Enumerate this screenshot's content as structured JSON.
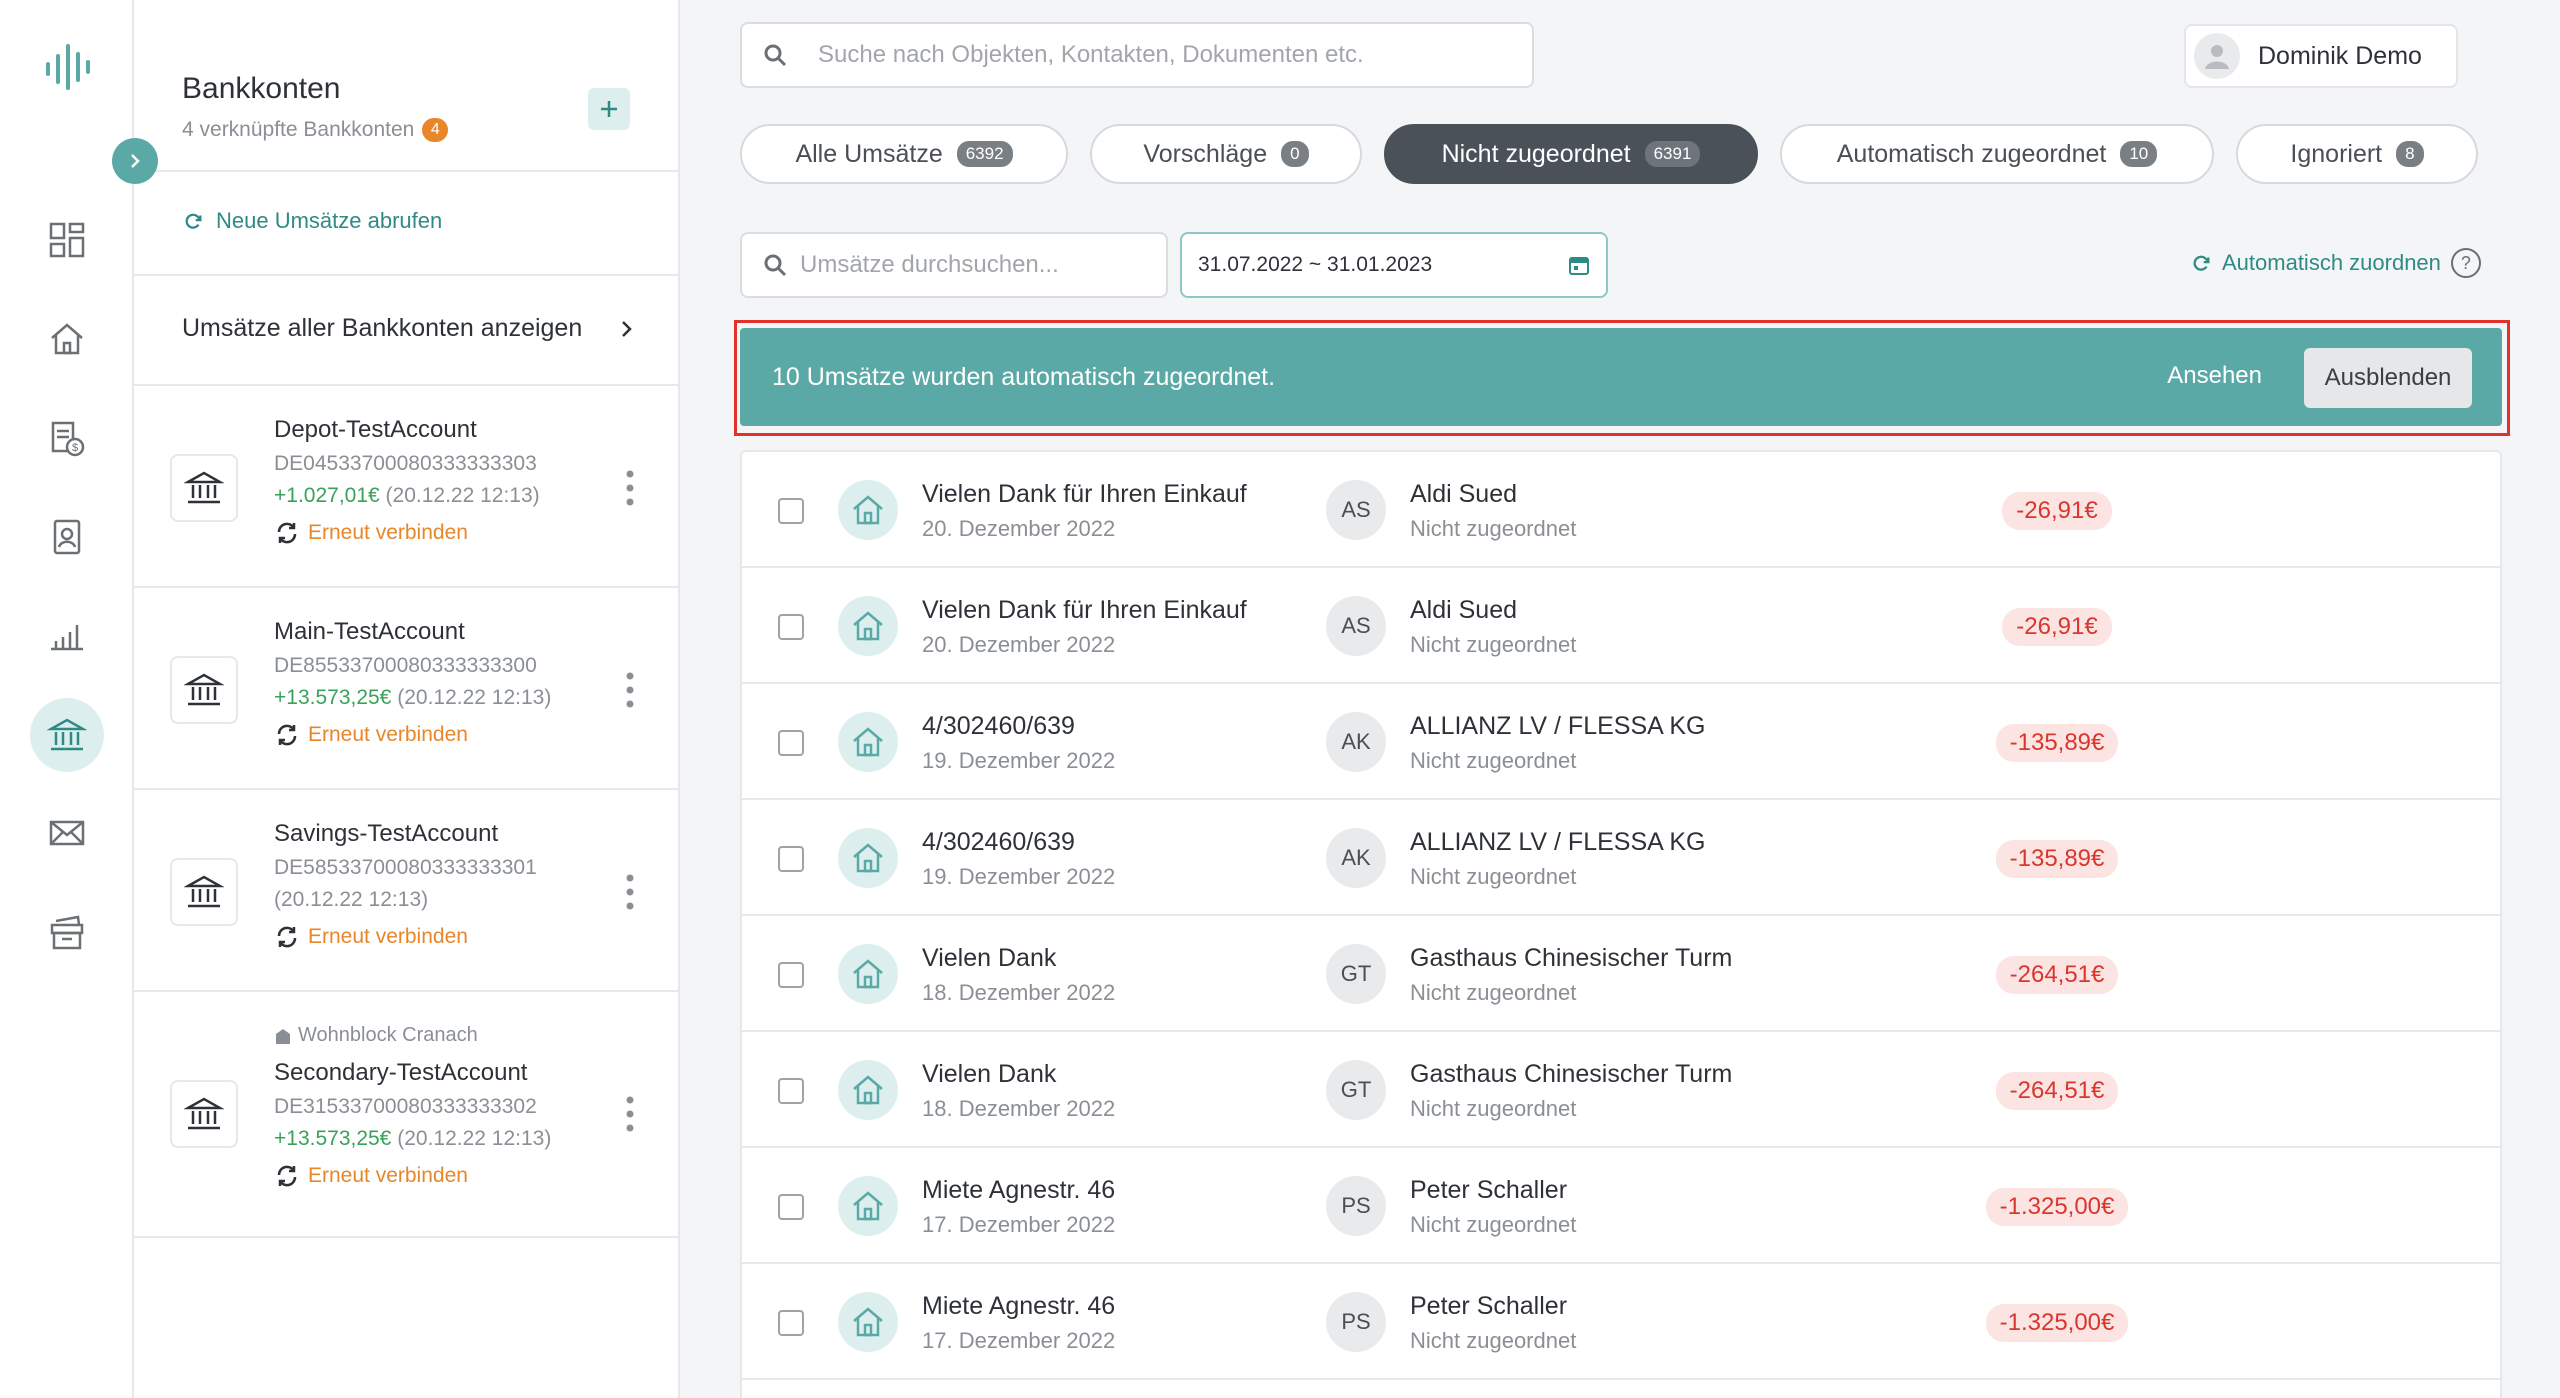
{
  "search": {
    "placeholder": "Suche nach Objekten, Kontakten, Dokumenten etc."
  },
  "user": {
    "name": "Dominik Demo"
  },
  "accounts_panel": {
    "title": "Bankkonten",
    "subtitle": "4 verknüpfte Bankkonten",
    "linked_count": "4",
    "refresh_label": "Neue Umsätze abrufen",
    "show_all_label": "Umsätze aller Bankkonten anzeigen",
    "items": [
      {
        "tag": "",
        "name": "Depot-TestAccount",
        "iban": "DE04533700080333333303",
        "balance": "+1.027,01€",
        "updated": "(20.12.22 12:13)",
        "reconnect": "Erneut verbinden"
      },
      {
        "tag": "",
        "name": "Main-TestAccount",
        "iban": "DE85533700080333333300",
        "balance": "+13.573,25€",
        "updated": "(20.12.22 12:13)",
        "reconnect": "Erneut verbinden"
      },
      {
        "tag": "",
        "name": "Savings-TestAccount",
        "iban": "DE58533700080333333301",
        "balance": "",
        "updated": "(20.12.22 12:13)",
        "reconnect": "Erneut verbinden"
      },
      {
        "tag": "Wohnblock Cranach",
        "name": "Secondary-TestAccount",
        "iban": "DE31533700080333333302",
        "balance": "+13.573,25€",
        "updated": "(20.12.22 12:13)",
        "reconnect": "Erneut verbinden"
      }
    ]
  },
  "tabs": [
    {
      "label": "Alle Umsätze",
      "count": "6392"
    },
    {
      "label": "Vorschläge",
      "count": "0"
    },
    {
      "label": "Nicht zugeordnet",
      "count": "6391"
    },
    {
      "label": "Automatisch zugeordnet",
      "count": "10"
    },
    {
      "label": "Ignoriert",
      "count": "8"
    }
  ],
  "filters": {
    "search_placeholder": "Umsätze durchsuchen...",
    "date_range": "31.07.2022 ~ 31.01.2023",
    "auto_assign_label": "Automatisch zuordnen",
    "help": "?"
  },
  "banner": {
    "message": "10 Umsätze wurden automatisch zugeordnet.",
    "view_label": "Ansehen",
    "hide_label": "Ausblenden"
  },
  "transactions": [
    {
      "description": "Vielen Dank für Ihren Einkauf",
      "date": "20. Dezember 2022",
      "initials": "AS",
      "counterparty": "Aldi Sued",
      "status": "Nicht zugeordnet",
      "amount": "-26,91€"
    },
    {
      "description": "Vielen Dank für Ihren Einkauf",
      "date": "20. Dezember 2022",
      "initials": "AS",
      "counterparty": "Aldi Sued",
      "status": "Nicht zugeordnet",
      "amount": "-26,91€"
    },
    {
      "description": "4/302460/639",
      "date": "19. Dezember 2022",
      "initials": "AK",
      "counterparty": "ALLIANZ LV / FLESSA KG",
      "status": "Nicht zugeordnet",
      "amount": "-135,89€"
    },
    {
      "description": "4/302460/639",
      "date": "19. Dezember 2022",
      "initials": "AK",
      "counterparty": "ALLIANZ LV / FLESSA KG",
      "status": "Nicht zugeordnet",
      "amount": "-135,89€"
    },
    {
      "description": "Vielen Dank",
      "date": "18. Dezember 2022",
      "initials": "GT",
      "counterparty": "Gasthaus Chinesischer Turm",
      "status": "Nicht zugeordnet",
      "amount": "-264,51€"
    },
    {
      "description": "Vielen Dank",
      "date": "18. Dezember 2022",
      "initials": "GT",
      "counterparty": "Gasthaus Chinesischer Turm",
      "status": "Nicht zugeordnet",
      "amount": "-264,51€"
    },
    {
      "description": "Miete Agnestr. 46",
      "date": "17. Dezember 2022",
      "initials": "PS",
      "counterparty": "Peter Schaller",
      "status": "Nicht zugeordnet",
      "amount": "-1.325,00€"
    },
    {
      "description": "Miete Agnestr. 46",
      "date": "17. Dezember 2022",
      "initials": "PS",
      "counterparty": "Peter Schaller",
      "status": "Nicht zugeordnet",
      "amount": "-1.325,00€"
    }
  ],
  "colors": {
    "accent": "#5aa9a6",
    "accent_dark": "#2f8a86",
    "warning": "#e8862a",
    "negative": "#d9362f",
    "positive": "#3aa15a",
    "highlight_frame": "#e0322b"
  },
  "icons": {
    "rail": [
      "logo-icon",
      "dashboard-icon",
      "home-icon",
      "documents-money-icon",
      "contacts-icon",
      "chart-icon",
      "bank-icon",
      "mail-icon",
      "archive-icon"
    ]
  }
}
